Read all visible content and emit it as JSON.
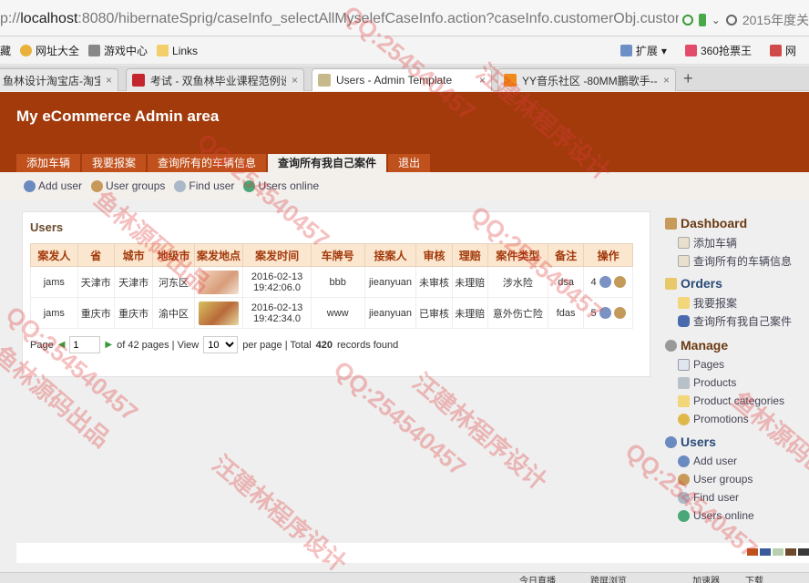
{
  "browser": {
    "url_prefix": "p://",
    "url_host": "localhost",
    "url_rest": ":8080/hibernateSprig/caseInfo_selectAllMyselefCaseInfo.action?caseInfo.customerObj.custom",
    "search_text": "2015年度关",
    "bookmarks": [
      "藏",
      "网址大全",
      "游戏中心",
      "Links"
    ],
    "bookmarks_right": [
      "扩展",
      "360抢票王",
      "网"
    ],
    "tabs": [
      {
        "label": "鱼林设计淘宝店-淘宝网"
      },
      {
        "label": "考试 - 双鱼林毕业课程范例设计"
      },
      {
        "label": "Users - Admin Template"
      },
      {
        "label": "YY音乐社区 -80MM鵬歌手--"
      }
    ],
    "active_tab": 2
  },
  "header": {
    "title": "My eCommerce Admin area"
  },
  "menu": [
    "添加车辆",
    "我要报案",
    "查询所有的车辆信息",
    "查询所有我自己案件",
    "退出"
  ],
  "menu_active": 3,
  "subnav": [
    "Add user",
    "User groups",
    "Find user",
    "Users online"
  ],
  "panel": {
    "title": "Users",
    "columns": [
      "案发人",
      "省",
      "城市",
      "地级市",
      "案发地点",
      "案发时间",
      "车牌号",
      "接案人",
      "审核",
      "理赔",
      "案件类型",
      "备注",
      "操作"
    ],
    "rows": [
      {
        "person": "jams",
        "province": "天津市",
        "city": "天津市",
        "district": "河东区",
        "date": "2016-02-13",
        "time": "19:42:06.0",
        "plate": "bbb",
        "receiver": "jieanyuan",
        "audit": "未审核",
        "claim": "未理赔",
        "type": "涉水险",
        "note": "dsa",
        "op_num": "4"
      },
      {
        "person": "jams",
        "province": "重庆市",
        "city": "重庆市",
        "district": "渝中区",
        "date": "2016-02-13",
        "time": "19:42:34.0",
        "plate": "www",
        "receiver": "jieanyuan",
        "audit": "已审核",
        "claim": "未理赔",
        "type": "意外伤亡险",
        "note": "fdas",
        "op_num": "5"
      }
    ],
    "pager": {
      "page_label": "Page",
      "page_value": "1",
      "of_pages": "of 42 pages | View",
      "per_page": "10",
      "per_page_label": "per page | Total",
      "total": "420",
      "found": "records found"
    }
  },
  "sidebar": {
    "dashboard": {
      "title": "Dashboard",
      "items": [
        "添加车辆",
        "查询所有的车辆信息"
      ]
    },
    "orders": {
      "title": "Orders",
      "items": [
        "我要报案",
        "查询所有我自己案件"
      ]
    },
    "manage": {
      "title": "Manage",
      "items": [
        "Pages",
        "Products",
        "Product categories",
        "Promotions"
      ]
    },
    "users": {
      "title": "Users",
      "items": [
        "Add user",
        "User groups",
        "Find user",
        "Users online"
      ]
    }
  },
  "status": [
    "今日直播",
    "跨屏浏览",
    "加速器",
    "下载"
  ],
  "watermark": [
    "QQ:254540457",
    "汪建林程序设计",
    "鱼林源码出品"
  ],
  "colors": {
    "header": "#a23a0c",
    "menu_tab": "#c1511c",
    "table_head": "#fbe7cf"
  }
}
